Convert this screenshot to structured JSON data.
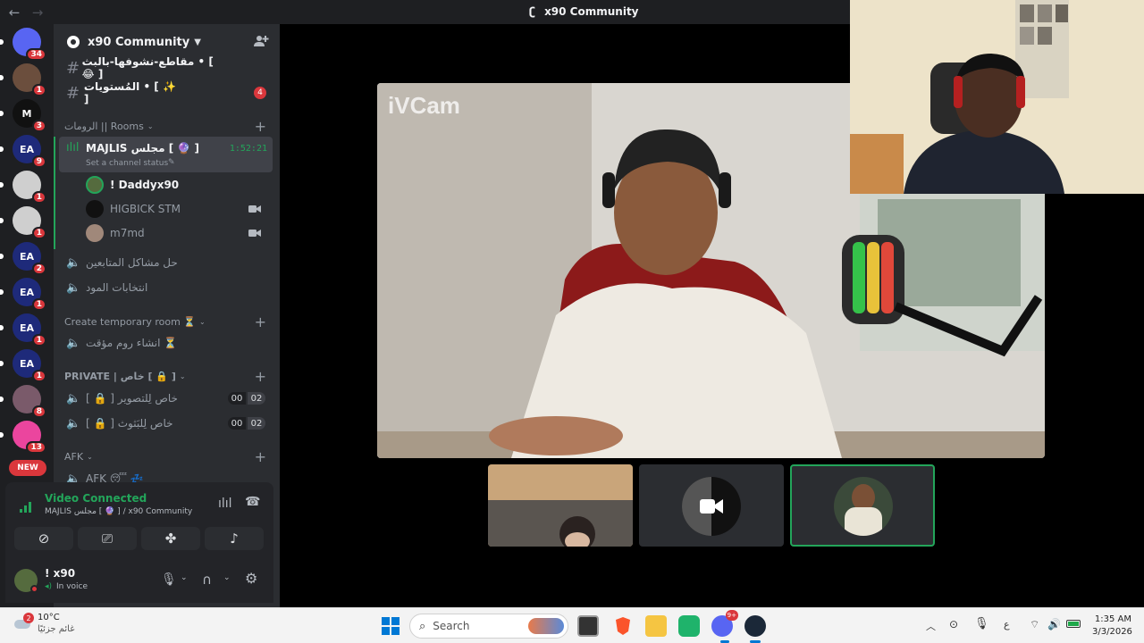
{
  "window": {
    "title": "x90 Community",
    "back": "←",
    "forward": "→"
  },
  "servers": [
    {
      "icon": "discord-icon",
      "badge": "34",
      "color": "#5865f2"
    },
    {
      "icon": "avatar",
      "badge": "1",
      "color": "#6b4e3d"
    },
    {
      "icon": "m-logo",
      "badge": "3",
      "color": "#111111",
      "text": "M"
    },
    {
      "icon": "ea-logo",
      "badge": "9",
      "color": "#1e2a7a",
      "text": "EA"
    },
    {
      "icon": "avatar",
      "badge": "1",
      "color": "#cfcfcf"
    },
    {
      "icon": "avatar",
      "badge": "1",
      "color": "#cfcfcf"
    },
    {
      "icon": "ea-logo",
      "badge": "2",
      "color": "#1e2a7a",
      "text": "EA"
    },
    {
      "icon": "ea-logo",
      "badge": "1",
      "color": "#1e2a7a",
      "text": "EA"
    },
    {
      "icon": "ea-logo",
      "badge": "1",
      "color": "#1e2a7a",
      "text": "EA"
    },
    {
      "icon": "ea-logo",
      "badge": "1",
      "color": "#1e2a7a",
      "text": "EA"
    },
    {
      "icon": "avatar",
      "badge": "8",
      "color": "#7a5a6a"
    },
    {
      "icon": "discord-icon",
      "badge": "13",
      "color": "#eb459e"
    }
  ],
  "new_badge": "NEW",
  "guild": {
    "name": "x90 Community"
  },
  "text_channels": [
    {
      "name": "مقاطع-نشوفها-بالبث • [ 😂 ]",
      "badge": ""
    },
    {
      "name": "المُستويات • [ ✨ ]",
      "badge": "4"
    }
  ],
  "categories": {
    "rooms": "الرومات || Rooms",
    "temp": "Create temporary room ⏳",
    "private": "PRIVATE | خاص [ 🔒 ]",
    "afk": "AFK"
  },
  "active_voice": {
    "name": "MAJLIS مجلس [ 🔮 ]",
    "status": "Set a channel status",
    "timer": "1:52:21"
  },
  "voice_users": [
    {
      "name": "! Daddyx90",
      "active": true
    },
    {
      "name": "HIGBICK STM",
      "camera": true
    },
    {
      "name": "m7md",
      "camera": true
    }
  ],
  "voice_channels": [
    {
      "name": "حل مشاكل المتابعين"
    },
    {
      "name": "انتخابات المود"
    }
  ],
  "temp_channels": [
    {
      "name": "انشاء روم مؤقت ⏳"
    }
  ],
  "private_channels": [
    {
      "name": "[ 🔒 ] خاص لِلتصوير",
      "c1": "00",
      "c2": "02"
    },
    {
      "name": "[ 🔒 ] خاص لِلبَثوث",
      "c1": "00",
      "c2": "02"
    }
  ],
  "afk_channel": {
    "name": "AFK 😴 💤"
  },
  "voice_status": {
    "title": "Video Connected",
    "subtitle": "MAJLIS مجلس [ 🔮 ] / x90 Community"
  },
  "user": {
    "name": "! x90",
    "status": "In voice"
  },
  "main_video": {
    "watermark": "iVCam"
  },
  "taskbar": {
    "weather_temp": "10°C",
    "weather_desc": "غائم جزئيًا",
    "weather_badge": "2",
    "search_placeholder": "Search",
    "lang": "ع",
    "time": "1:35 AM",
    "date": "3/3/2026",
    "discord_badge": "9+"
  },
  "colors": {
    "accent": "#23a55a",
    "danger": "#da373c",
    "blurple": "#5865f2",
    "sidebar": "#2b2d31",
    "rail": "#1e1f22"
  }
}
